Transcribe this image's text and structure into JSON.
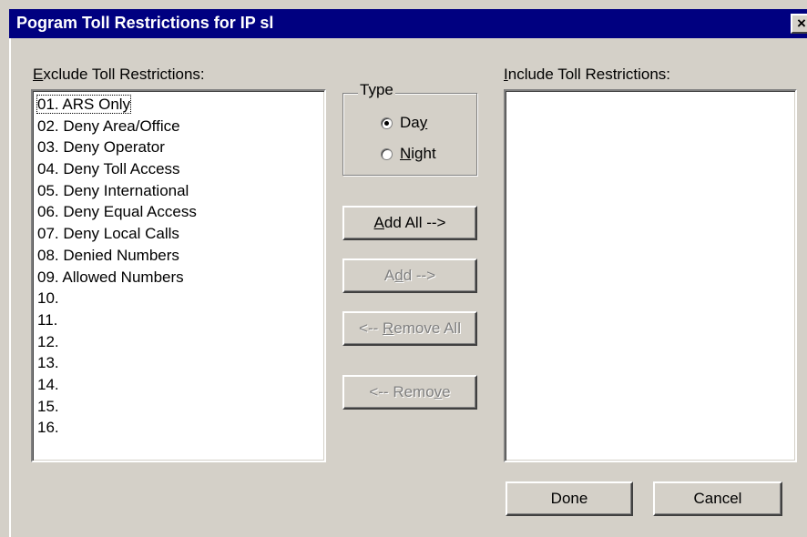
{
  "window": {
    "title": "Pogram Toll Restrictions for IP sl",
    "close_glyph": "×"
  },
  "exclude": {
    "label_mnemonic": "E",
    "label_rest": "xclude Toll Restrictions:",
    "items": [
      "01. ARS Only",
      "02. Deny Area/Office",
      "03. Deny Operator",
      "04. Deny Toll Access",
      "05. Deny International",
      "06. Deny Equal Access",
      "07. Deny Local Calls",
      "08. Denied Numbers",
      "09. Allowed Numbers",
      "10.",
      "11.",
      "12.",
      "13.",
      "14.",
      "15.",
      "16."
    ]
  },
  "include": {
    "label_mnemonic": "I",
    "label_rest": "nclude Toll Restrictions:",
    "items": []
  },
  "type_group": {
    "legend": "Type",
    "day_pre": "Da",
    "day_mn": "y",
    "night_mn": "N",
    "night_rest": "ight",
    "selected": "Day"
  },
  "buttons": {
    "add_all_mn": "A",
    "add_all_rest": "dd All -->",
    "add_pre": "A",
    "add_mn": "d",
    "add_rest": "d -->",
    "remove_all_pre": "<-- ",
    "remove_all_mn": "R",
    "remove_all_rest": "emove All",
    "remove_pre": "<-- Remo",
    "remove_mn": "v",
    "remove_rest": "e",
    "done": "Done",
    "cancel": "Cancel"
  }
}
